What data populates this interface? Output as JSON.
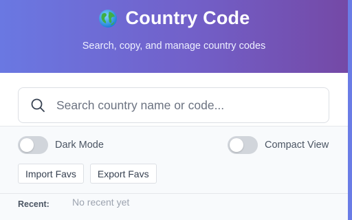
{
  "header": {
    "icon": "globe-icon",
    "title": "Country Code",
    "subtitle": "Search, copy, and manage country codes"
  },
  "search": {
    "icon": "search-icon",
    "value": "",
    "placeholder": "Search country name or code..."
  },
  "toggles": {
    "dark_mode": {
      "label": "Dark Mode",
      "on": false
    },
    "compact_view": {
      "label": "Compact View",
      "on": false
    }
  },
  "buttons": {
    "import_label": "Import Favs",
    "export_label": "Export Favs"
  },
  "recent": {
    "label": "Recent:",
    "empty_text": "No recent yet"
  },
  "colors": {
    "header_gradient_start": "#6a78e2",
    "header_gradient_end": "#7449a6",
    "toggle_off": "#d1d5db",
    "background": "#f8fafc"
  }
}
